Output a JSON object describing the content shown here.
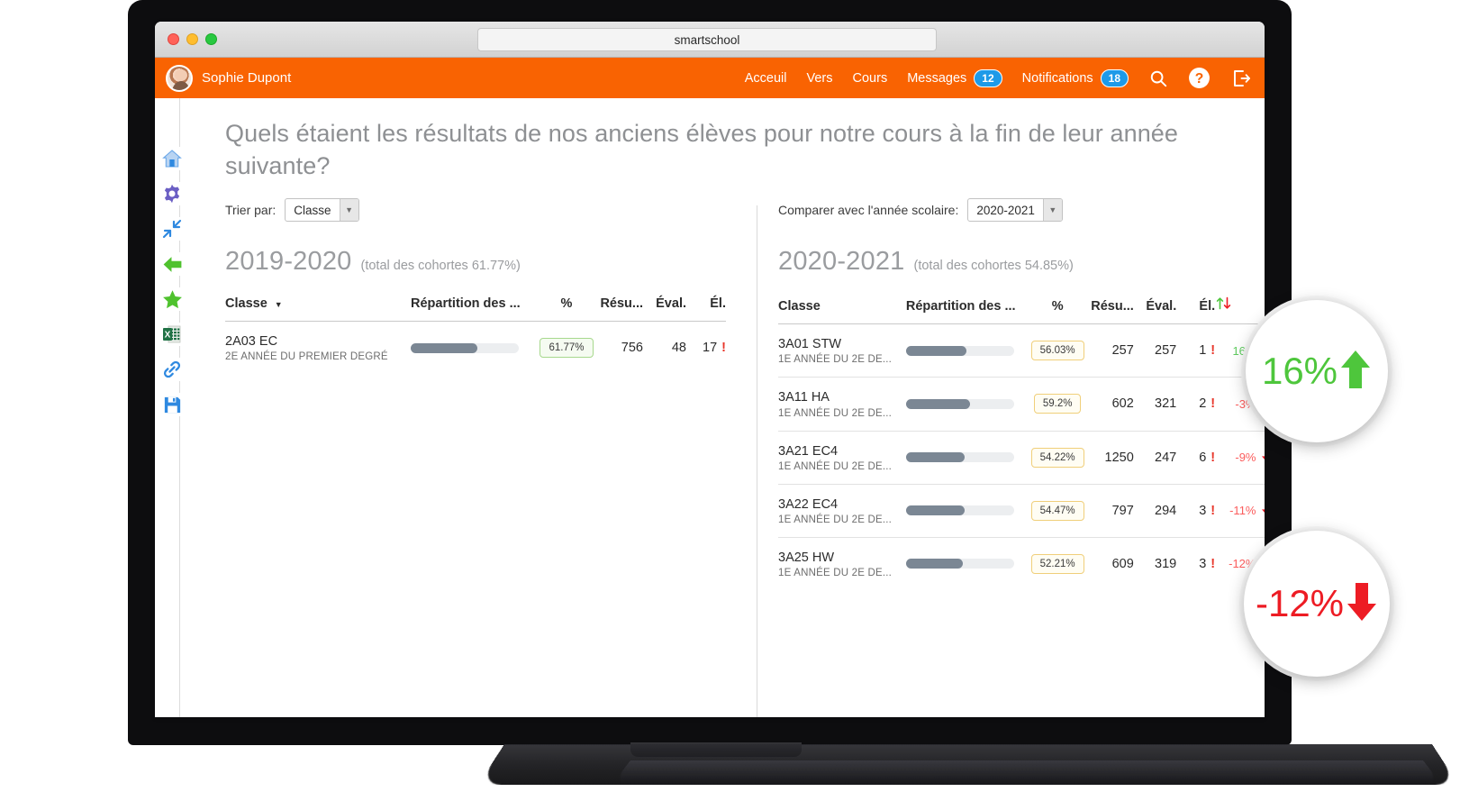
{
  "browser": {
    "url": "smartschool"
  },
  "appbar": {
    "user": "Sophie Dupont",
    "links": [
      {
        "label": "Acceuil",
        "badge": null
      },
      {
        "label": "Vers",
        "badge": null
      },
      {
        "label": "Cours",
        "badge": null
      },
      {
        "label": "Messages",
        "badge": "12"
      },
      {
        "label": "Notifications",
        "badge": "18"
      }
    ],
    "icons": [
      "search-icon",
      "help-icon",
      "logout-icon"
    ],
    "accent": "#f96302",
    "badge_color": "#1e9ae8"
  },
  "sidebar": {
    "icons": [
      "home-icon",
      "gear-icon",
      "collapse-icon",
      "back-arrow-icon",
      "star-icon",
      "excel-export-icon",
      "link-icon",
      "save-icon"
    ]
  },
  "page": {
    "title": "Quels étaient les résultats de nos anciens élèves pour notre cours à la fin de leur année suivante?"
  },
  "left_panel": {
    "control_label": "Trier par:",
    "control_value": "Classe",
    "year": "2019-2020",
    "year_sub": "(total des cohortes 61.77%)",
    "headers": [
      "Classe",
      "Répartition des ...",
      "%",
      "Résu...",
      "Éval.",
      "Él."
    ],
    "rows": [
      {
        "class": "2A03 EC",
        "sub": "2E ANNÉE DU PREMIER DEGRÉ",
        "bar": 61.77,
        "pct": "61.77%",
        "pct_style": "green",
        "resu": "756",
        "eval": "48",
        "el": "17",
        "warn": "!"
      }
    ]
  },
  "right_panel": {
    "control_label": "Comparer avec l'année scolaire:",
    "control_value": "2020-2021",
    "year": "2020-2021",
    "year_sub": "(total des cohortes 54.85%)",
    "headers": [
      "Classe",
      "Répartition des ...",
      "%",
      "Résu...",
      "Éval.",
      "Él.",
      "⇅"
    ],
    "rows": [
      {
        "class": "3A01 STW",
        "sub": "1E ANNÉE DU 2E DE...",
        "bar": 56.03,
        "pct": "56.03%",
        "pct_style": "yellow",
        "resu": "257",
        "eval": "257",
        "el": "1",
        "warn": "!",
        "delta": "16%",
        "dir": "up"
      },
      {
        "class": "3A11 HA",
        "sub": "1E ANNÉE DU 2E DE...",
        "bar": 59.2,
        "pct": "59.2%",
        "pct_style": "yellow",
        "resu": "602",
        "eval": "321",
        "el": "2",
        "warn": "!",
        "delta": "-3%",
        "dir": "down"
      },
      {
        "class": "3A21 EC4",
        "sub": "1E ANNÉE DU 2E DE...",
        "bar": 54.22,
        "pct": "54.22%",
        "pct_style": "yellow",
        "resu": "1250",
        "eval": "247",
        "el": "6",
        "warn": "!",
        "delta": "-9%",
        "dir": "down"
      },
      {
        "class": "3A22 EC4",
        "sub": "1E ANNÉE DU 2E DE...",
        "bar": 54.47,
        "pct": "54.47%",
        "pct_style": "yellow",
        "resu": "797",
        "eval": "294",
        "el": "3",
        "warn": "!",
        "delta": "-11%",
        "dir": "down"
      },
      {
        "class": "3A25 HW",
        "sub": "1E ANNÉE DU 2E DE...",
        "bar": 52.21,
        "pct": "52.21%",
        "pct_style": "yellow",
        "resu": "609",
        "eval": "319",
        "el": "3",
        "warn": "!",
        "delta": "-12%",
        "dir": "down"
      }
    ]
  },
  "callouts": [
    {
      "text": "16%",
      "dir": "up",
      "color": "#4ec63c"
    },
    {
      "text": "-12%",
      "dir": "down",
      "color": "#ed1c24"
    }
  ]
}
